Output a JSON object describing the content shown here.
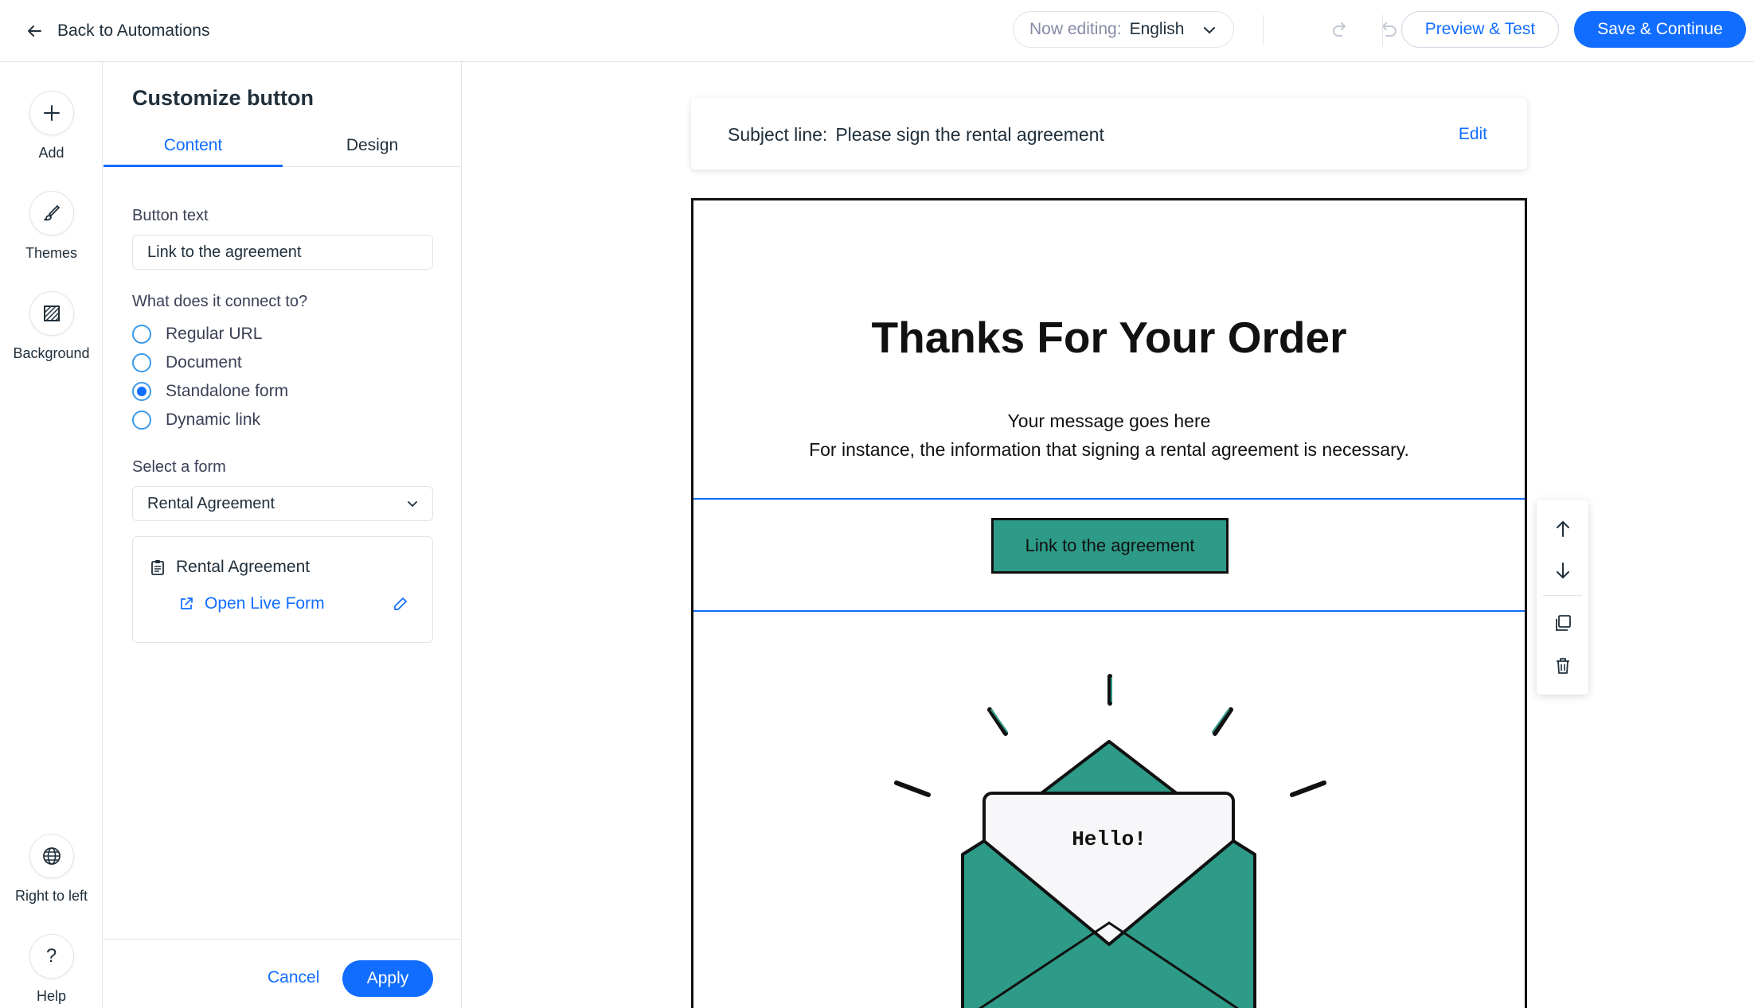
{
  "topbar": {
    "back_label": "Back to Automations",
    "now_editing_label": "Now editing:",
    "language": "English",
    "preview_label": "Preview & Test",
    "save_label": "Save & Continue"
  },
  "rail": {
    "add": "Add",
    "themes": "Themes",
    "background": "Background",
    "rtl": "Right to left",
    "help": "Help"
  },
  "panel": {
    "title": "Customize button",
    "tabs": {
      "content": "Content",
      "design": "Design"
    },
    "button_text_label": "Button text",
    "button_text_value": "Link to the agreement",
    "connect_label": "What does it connect to?",
    "options": [
      "Regular URL",
      "Document",
      "Standalone form",
      "Dynamic link"
    ],
    "selected_option": "Standalone form",
    "select_form_label": "Select a form",
    "selected_form": "Rental Agreement",
    "form_card_title": "Rental Agreement",
    "open_live_form": "Open Live Form",
    "cancel": "Cancel",
    "apply": "Apply"
  },
  "email": {
    "subject_prefix": "Subject line:",
    "subject": "Please sign the rental agreement",
    "edit": "Edit",
    "title": "Thanks For Your Order",
    "message_line1": "Your message goes here",
    "message_line2": "For instance, the information that signing a rental agreement is necessary.",
    "cta_label": "Link to the agreement",
    "letter_text": "Hello!"
  },
  "colors": {
    "accent": "#116dff",
    "cta_green": "#2d9b87",
    "text": "#20303c"
  }
}
